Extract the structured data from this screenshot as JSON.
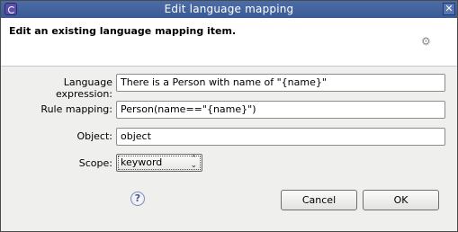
{
  "window": {
    "title": "Edit language mapping",
    "close_glyph": "✕"
  },
  "banner": {
    "message": "Edit an existing language mapping item.",
    "icon": "gear-icon"
  },
  "form": {
    "language_expression": {
      "label": "Language expression:",
      "value": "There is a Person with name of \"{name}\""
    },
    "rule_mapping": {
      "label": "Rule mapping:",
      "value": "Person(name==\"{name}\")"
    },
    "object": {
      "label": "Object:",
      "value": "object"
    },
    "scope": {
      "label": "Scope:",
      "selected": "keyword"
    }
  },
  "buttons": {
    "help_glyph": "?",
    "cancel": "Cancel",
    "ok": "OK"
  }
}
